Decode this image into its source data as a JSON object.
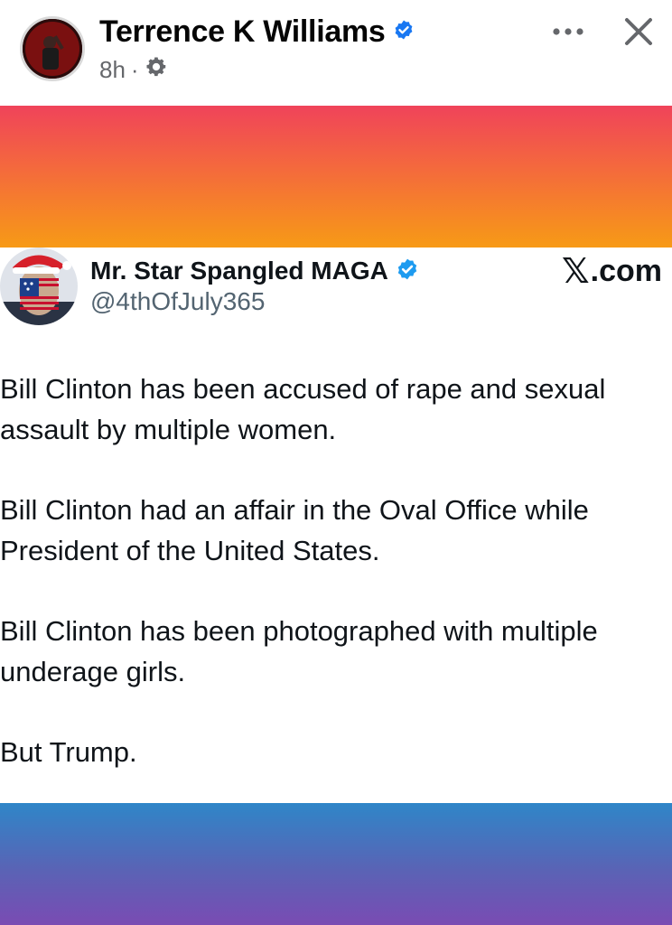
{
  "post": {
    "author": "Terrence K Williams",
    "time": "8h",
    "separator": "·",
    "icons": {
      "verified": "verified-badge-icon",
      "audience": "gear-icon",
      "more": "more-horizontal-icon",
      "close": "close-icon"
    }
  },
  "tweet": {
    "name": "Mr. Star Spangled MAGA",
    "handle": "@4thOfJuly365",
    "source_logo": "𝕏",
    "source_suffix": ".com",
    "paragraphs": [
      "Bill Clinton has been accused of rape and sexual assault by multiple women.",
      "Bill Clinton had an affair in the Oval Office while President of the United States.",
      "Bill Clinton has been photographed with multiple underage girls.",
      "But Trump."
    ]
  },
  "colors": {
    "verified_blue": "#1877f2",
    "meta_gray": "#65676b",
    "band_top": [
      "#f0435a",
      "#f79a16"
    ],
    "band_bottom": [
      "#2f86c8",
      "#7a4bb3"
    ]
  }
}
